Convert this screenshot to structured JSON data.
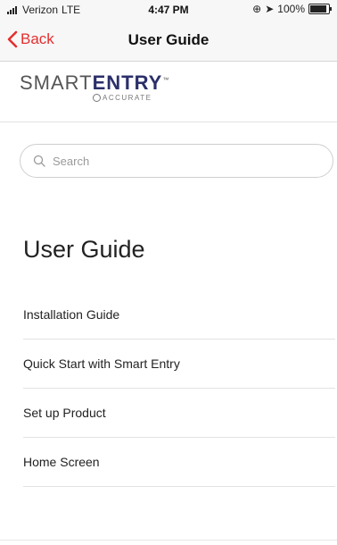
{
  "status": {
    "carrier": "Verizon",
    "network": "LTE",
    "time": "4:47 PM",
    "battery": "100%",
    "battery_level": 1.0
  },
  "nav": {
    "back_label": "Back",
    "title": "User Guide"
  },
  "brand": {
    "name_part1": "SMART",
    "name_part2": "ENTRY",
    "tm": "™",
    "sub": "ACCURATE"
  },
  "search": {
    "placeholder": "Search",
    "value": ""
  },
  "page": {
    "title": "User Guide"
  },
  "items": [
    {
      "label": "Installation Guide"
    },
    {
      "label": "Quick Start with Smart Entry"
    },
    {
      "label": "Set up Product"
    },
    {
      "label": "Home Screen"
    }
  ],
  "colors": {
    "accent": "#e3302f",
    "brand": "#2b2f6a"
  }
}
